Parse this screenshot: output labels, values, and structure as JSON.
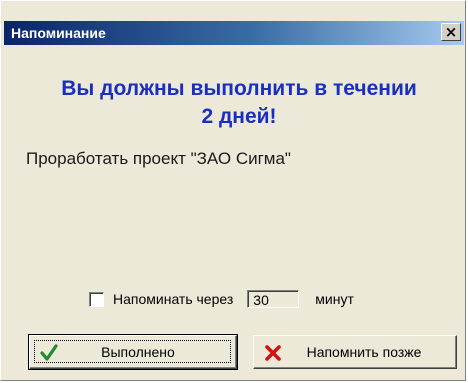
{
  "window": {
    "title": "Напоминание",
    "close_glyph": "×"
  },
  "heading": {
    "line1": "Вы должны выполнить в течении",
    "line2": "2 дней!"
  },
  "message": "Проработать проект  \"ЗАО Сигма\"",
  "remind": {
    "checked": false,
    "label": "Напоминать через",
    "minutes_value": "30",
    "unit": "минут"
  },
  "buttons": {
    "done": {
      "label": "Выполнено",
      "icon": "checkmark-icon",
      "icon_color": "#1e8b2c"
    },
    "later": {
      "label": "Напомнить позже",
      "icon": "red-x-icon",
      "icon_color": "#d41010"
    }
  },
  "colors": {
    "heading": "#1a2fbf",
    "titlebar_start": "#0a246a",
    "titlebar_end": "#a6caf0",
    "face": "#ece9d8"
  }
}
